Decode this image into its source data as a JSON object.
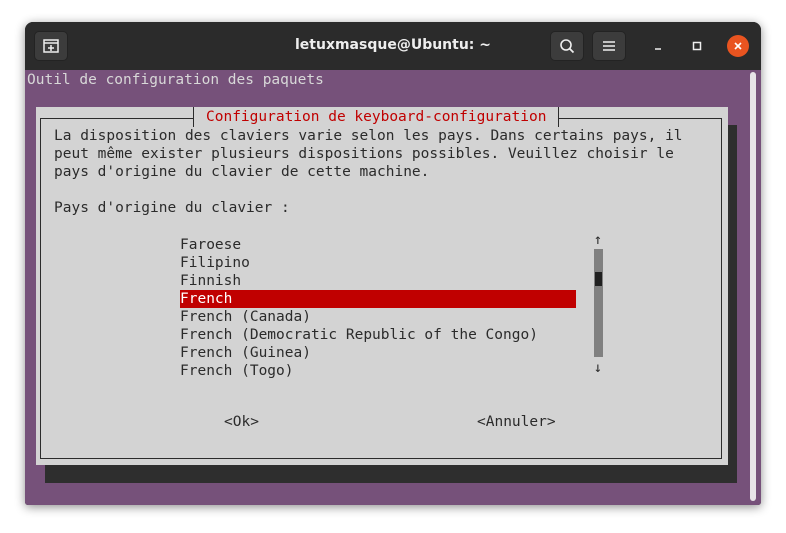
{
  "window": {
    "title": "letuxmasque@Ubuntu: ~"
  },
  "terminal": {
    "header_line": "Outil de configuration des paquets"
  },
  "dialog": {
    "title": "Configuration de keyboard-configuration",
    "description_lines": [
      "La disposition des claviers varie selon les pays. Dans certains pays, il",
      "peut même exister plusieurs dispositions possibles. Veuillez choisir le",
      "pays d'origine du clavier de cette machine."
    ],
    "prompt": "Pays d'origine du clavier :",
    "options": [
      "Faroese",
      "Filipino",
      "Finnish",
      "French",
      "French (Canada)",
      "French (Democratic Republic of the Congo)",
      "French (Guinea)",
      "French (Togo)"
    ],
    "selected_option": "French",
    "scroll_up_arrow": "↑",
    "scroll_down_arrow": "↓",
    "ok_label": "<Ok>",
    "cancel_label": "<Annuler>"
  },
  "colors": {
    "terminal_bg": "#76517a",
    "dialog_bg": "#d3d3d3",
    "accent_red": "#c00000",
    "close_orange": "#e95420"
  },
  "icons": [
    "new-tab-icon",
    "search-icon",
    "hamburger-menu-icon",
    "minimize-icon",
    "maximize-icon",
    "close-icon"
  ]
}
